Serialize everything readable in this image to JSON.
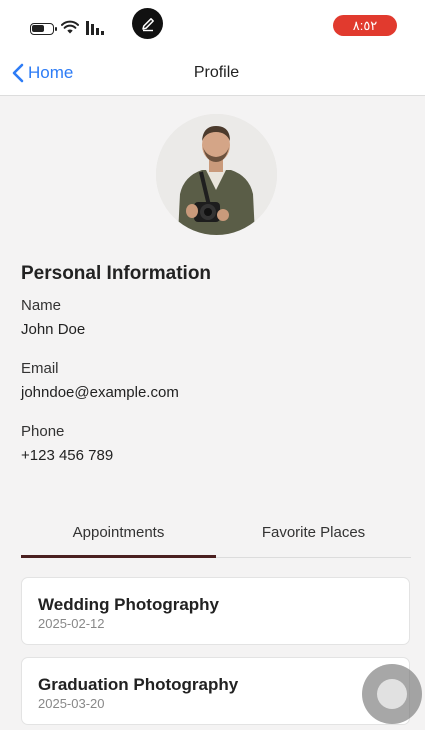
{
  "status_bar": {
    "time": "٨:٥٢",
    "time_color": "#e13a2e",
    "icons": [
      "battery-icon",
      "wifi-icon",
      "cellular-signal-icon",
      "edit-icon"
    ]
  },
  "nav": {
    "back_label": "Home",
    "title": "Profile",
    "accent_color": "#2d7cf6"
  },
  "section": {
    "title": "Personal Information"
  },
  "fields": {
    "name_label": "Name",
    "name_value": "John Doe",
    "email_label": "Email",
    "email_value": "johndoe@example.com",
    "phone_label": "Phone",
    "phone_value": "+123 456 789"
  },
  "tabs": [
    {
      "label": "Appointments",
      "selected": true
    },
    {
      "label": "Favorite Places",
      "selected": false
    }
  ],
  "appointments": [
    {
      "title": "Wedding Photography",
      "date": "2025-02-12"
    },
    {
      "title": "Graduation Photography",
      "date": "2025-03-20"
    }
  ]
}
